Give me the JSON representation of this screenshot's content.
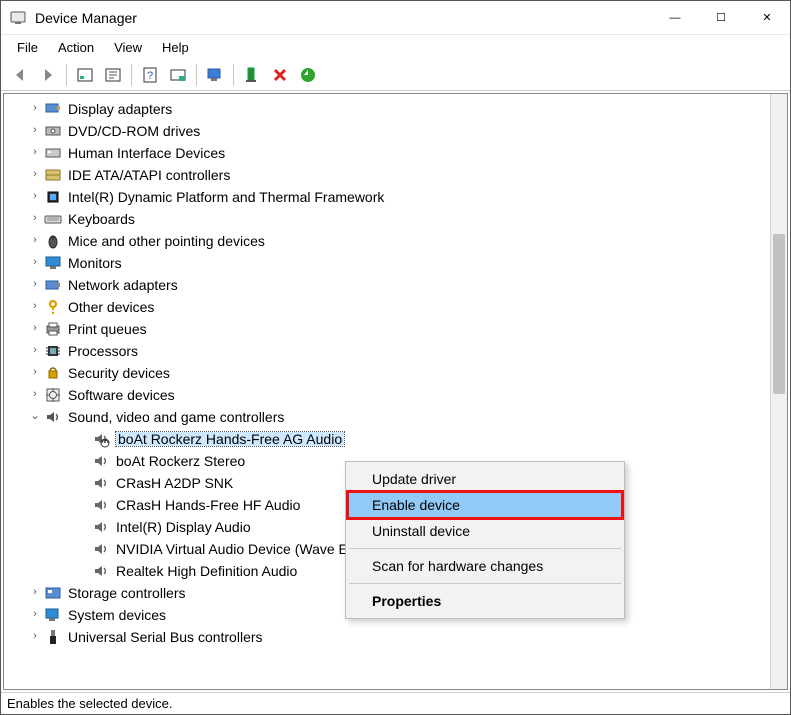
{
  "window": {
    "title": "Device Manager"
  },
  "menu": {
    "file": "File",
    "action": "Action",
    "view": "View",
    "help": "Help"
  },
  "tree": {
    "items": [
      {
        "label": "Display adapters",
        "icon": "display-adapter-icon",
        "expandable": true
      },
      {
        "label": "DVD/CD-ROM drives",
        "icon": "dvd-drive-icon",
        "expandable": true
      },
      {
        "label": "Human Interface Devices",
        "icon": "hid-icon",
        "expandable": true
      },
      {
        "label": "IDE ATA/ATAPI controllers",
        "icon": "ide-controller-icon",
        "expandable": true
      },
      {
        "label": "Intel(R) Dynamic Platform and Thermal Framework",
        "icon": "chip-icon",
        "expandable": true
      },
      {
        "label": "Keyboards",
        "icon": "keyboard-icon",
        "expandable": true
      },
      {
        "label": "Mice and other pointing devices",
        "icon": "mouse-icon",
        "expandable": true
      },
      {
        "label": "Monitors",
        "icon": "monitor-icon",
        "expandable": true
      },
      {
        "label": "Network adapters",
        "icon": "network-adapter-icon",
        "expandable": true
      },
      {
        "label": "Other devices",
        "icon": "other-device-icon",
        "expandable": true
      },
      {
        "label": "Print queues",
        "icon": "printer-icon",
        "expandable": true
      },
      {
        "label": "Processors",
        "icon": "processor-icon",
        "expandable": true
      },
      {
        "label": "Security devices",
        "icon": "security-device-icon",
        "expandable": true
      },
      {
        "label": "Software devices",
        "icon": "software-device-icon",
        "expandable": true
      },
      {
        "label": "Sound, video and game controllers",
        "icon": "sound-icon",
        "expandable": true,
        "expanded": true
      },
      {
        "label": "Storage controllers",
        "icon": "storage-controller-icon",
        "expandable": true
      },
      {
        "label": "System devices",
        "icon": "system-device-icon",
        "expandable": true
      },
      {
        "label": "Universal Serial Bus controllers",
        "icon": "usb-icon",
        "expandable": true
      }
    ],
    "sound_children": [
      {
        "label": "boAt Rockerz Hands-Free AG Audio",
        "selected": true,
        "disabled": true
      },
      {
        "label": "boAt Rockerz Stereo"
      },
      {
        "label": "CRasH A2DP SNK"
      },
      {
        "label": "CRasH Hands-Free HF Audio"
      },
      {
        "label": "Intel(R) Display Audio"
      },
      {
        "label": "NVIDIA Virtual Audio Device (Wave Extensible) (WDM)"
      },
      {
        "label": "Realtek High Definition Audio"
      }
    ]
  },
  "context_menu": {
    "update": "Update driver",
    "enable": "Enable device",
    "uninstall": "Uninstall device",
    "scan": "Scan for hardware changes",
    "properties": "Properties"
  },
  "status": {
    "text": "Enables the selected device."
  }
}
